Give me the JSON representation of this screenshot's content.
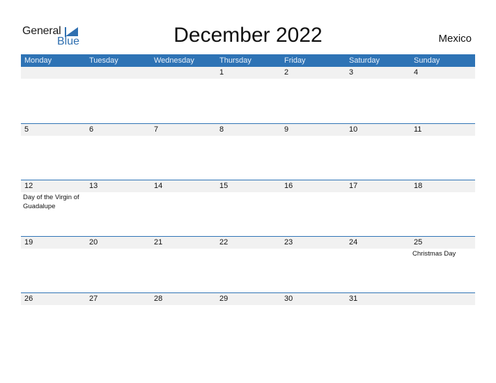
{
  "logo": {
    "general": "General",
    "blue": "Blue"
  },
  "title": "December 2022",
  "country": "Mexico",
  "colors": {
    "accent": "#2e73b5",
    "date_strip": "#f1f1f1"
  },
  "weekdays": [
    "Monday",
    "Tuesday",
    "Wednesday",
    "Thursday",
    "Friday",
    "Saturday",
    "Sunday"
  ],
  "weeks": [
    {
      "days": [
        {
          "num": "",
          "event": ""
        },
        {
          "num": "",
          "event": ""
        },
        {
          "num": "",
          "event": ""
        },
        {
          "num": "1",
          "event": ""
        },
        {
          "num": "2",
          "event": ""
        },
        {
          "num": "3",
          "event": ""
        },
        {
          "num": "4",
          "event": ""
        }
      ]
    },
    {
      "days": [
        {
          "num": "5",
          "event": ""
        },
        {
          "num": "6",
          "event": ""
        },
        {
          "num": "7",
          "event": ""
        },
        {
          "num": "8",
          "event": ""
        },
        {
          "num": "9",
          "event": ""
        },
        {
          "num": "10",
          "event": ""
        },
        {
          "num": "11",
          "event": ""
        }
      ]
    },
    {
      "days": [
        {
          "num": "12",
          "event": "Day of the Virgin of Guadalupe"
        },
        {
          "num": "13",
          "event": ""
        },
        {
          "num": "14",
          "event": ""
        },
        {
          "num": "15",
          "event": ""
        },
        {
          "num": "16",
          "event": ""
        },
        {
          "num": "17",
          "event": ""
        },
        {
          "num": "18",
          "event": ""
        }
      ]
    },
    {
      "days": [
        {
          "num": "19",
          "event": ""
        },
        {
          "num": "20",
          "event": ""
        },
        {
          "num": "21",
          "event": ""
        },
        {
          "num": "22",
          "event": ""
        },
        {
          "num": "23",
          "event": ""
        },
        {
          "num": "24",
          "event": ""
        },
        {
          "num": "25",
          "event": "Christmas Day"
        }
      ]
    },
    {
      "days": [
        {
          "num": "26",
          "event": ""
        },
        {
          "num": "27",
          "event": ""
        },
        {
          "num": "28",
          "event": ""
        },
        {
          "num": "29",
          "event": ""
        },
        {
          "num": "30",
          "event": ""
        },
        {
          "num": "31",
          "event": ""
        },
        {
          "num": "",
          "event": ""
        }
      ]
    }
  ]
}
